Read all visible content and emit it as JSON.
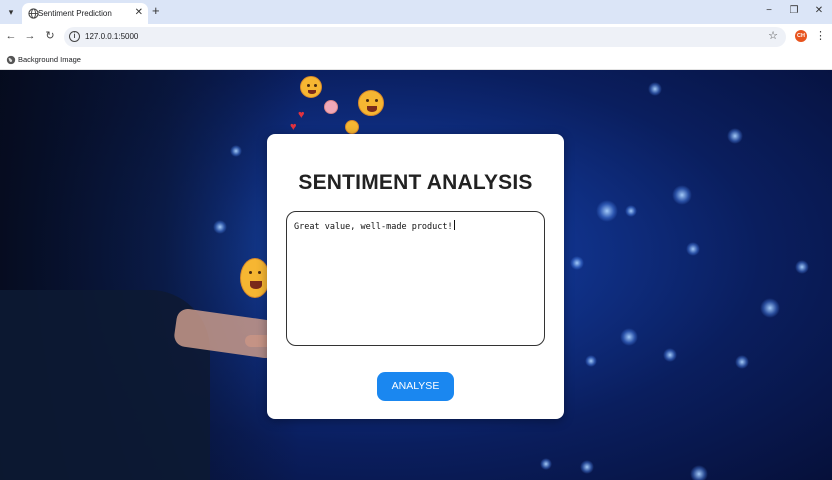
{
  "browser": {
    "tab": {
      "title": "Sentiment Prediction",
      "close": "✕"
    },
    "tab_menu": "▾",
    "new_tab": "+",
    "window": {
      "minimize": "−",
      "restore": "❐",
      "close": "✕"
    },
    "nav": {
      "back": "←",
      "forward": "→",
      "reload": "↻"
    },
    "address": {
      "info": "i",
      "url": "127.0.0.1:5000",
      "bookmark": "☆"
    },
    "profile_initials": "CH",
    "menu": "⋮",
    "bookmarks_bar": {
      "item_label": "Background Image"
    }
  },
  "app": {
    "heading": "SENTIMENT ANALYSIS",
    "review_text": "Great value, well-made product!",
    "analyse_label": "ANALYSE"
  },
  "colors": {
    "button": "#1a87f0",
    "avatar": "#e8541e",
    "background": "#10328a"
  }
}
